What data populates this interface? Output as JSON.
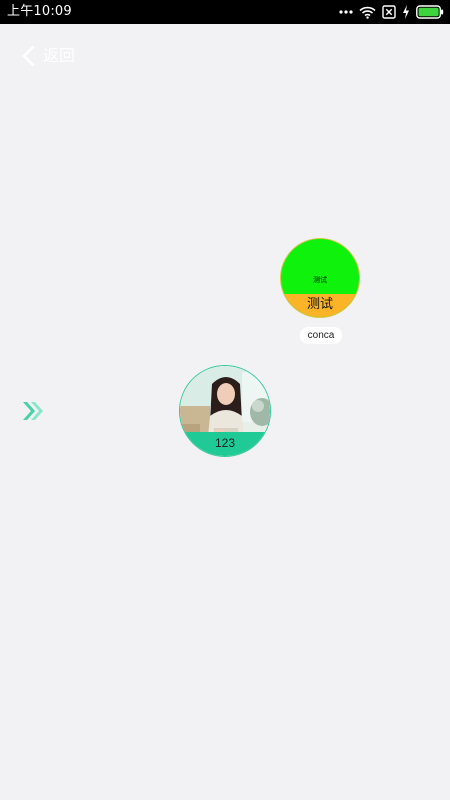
{
  "status_bar": {
    "time": "上午10:09",
    "icons": [
      "more-dots-icon",
      "wifi-icon",
      "sim-no-signal-icon",
      "charging-icon",
      "battery-icon"
    ],
    "battery_color": "#3ed43e"
  },
  "nav": {
    "back_label": "返回",
    "back_icon": "chevron-left-icon"
  },
  "nodes": [
    {
      "id": "node-a",
      "top_text": "测试",
      "bottom_label": "测试",
      "caption": "conca",
      "colors": {
        "top": "#0ef20c",
        "bottom": "#fbb328",
        "border": "#d6c84a"
      }
    },
    {
      "id": "node-b",
      "image": "portrait-photo",
      "bottom_label": "123",
      "colors": {
        "bottom": "#20ca96",
        "border": "#30c898"
      }
    }
  ],
  "expand_control": {
    "icon": "double-chevron-right-icon",
    "color": "#46d2a6"
  },
  "background_color": "#f2f1f4"
}
